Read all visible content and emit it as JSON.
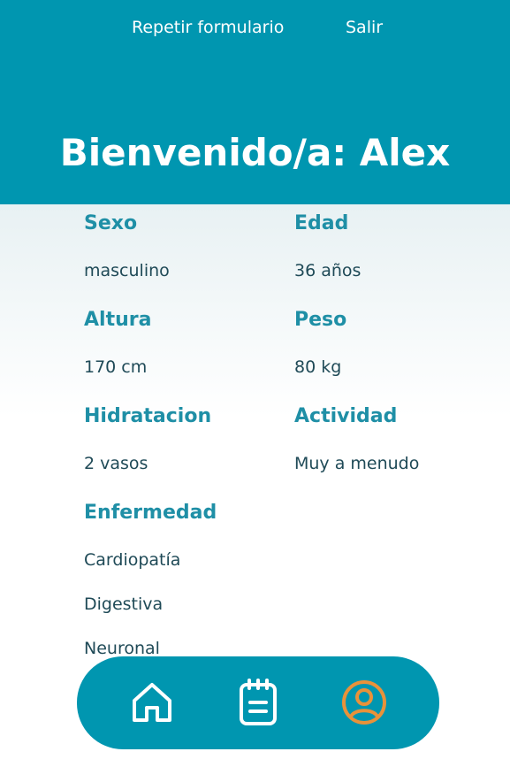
{
  "header": {
    "repeat_label": "Repetir formulario",
    "exit_label": "Salir",
    "welcome": "Bienvenido/a: Alex"
  },
  "profile": {
    "sexo": {
      "label": "Sexo",
      "value": "masculino"
    },
    "edad": {
      "label": "Edad",
      "value": "36 años"
    },
    "altura": {
      "label": "Altura",
      "value": "170 cm"
    },
    "peso": {
      "label": "Peso",
      "value": "80 kg"
    },
    "hidratacion": {
      "label": "Hidratacion",
      "value": "2 vasos"
    },
    "actividad": {
      "label": "Actividad",
      "value": "Muy a menudo"
    },
    "enfermedad": {
      "label": "Enfermedad",
      "values": [
        "Cardiopatía",
        "Digestiva",
        "Neuronal"
      ]
    }
  },
  "bottom_nav": {
    "items": [
      {
        "icon": "home-icon",
        "active": false
      },
      {
        "icon": "notepad-icon",
        "active": false
      },
      {
        "icon": "user-icon",
        "active": true
      }
    ],
    "color_active": "#e8923a",
    "color_inactive": "#ffffff"
  },
  "colors": {
    "primary": "#0096b0",
    "label": "#1f8fa6",
    "value": "#1f4a57"
  }
}
